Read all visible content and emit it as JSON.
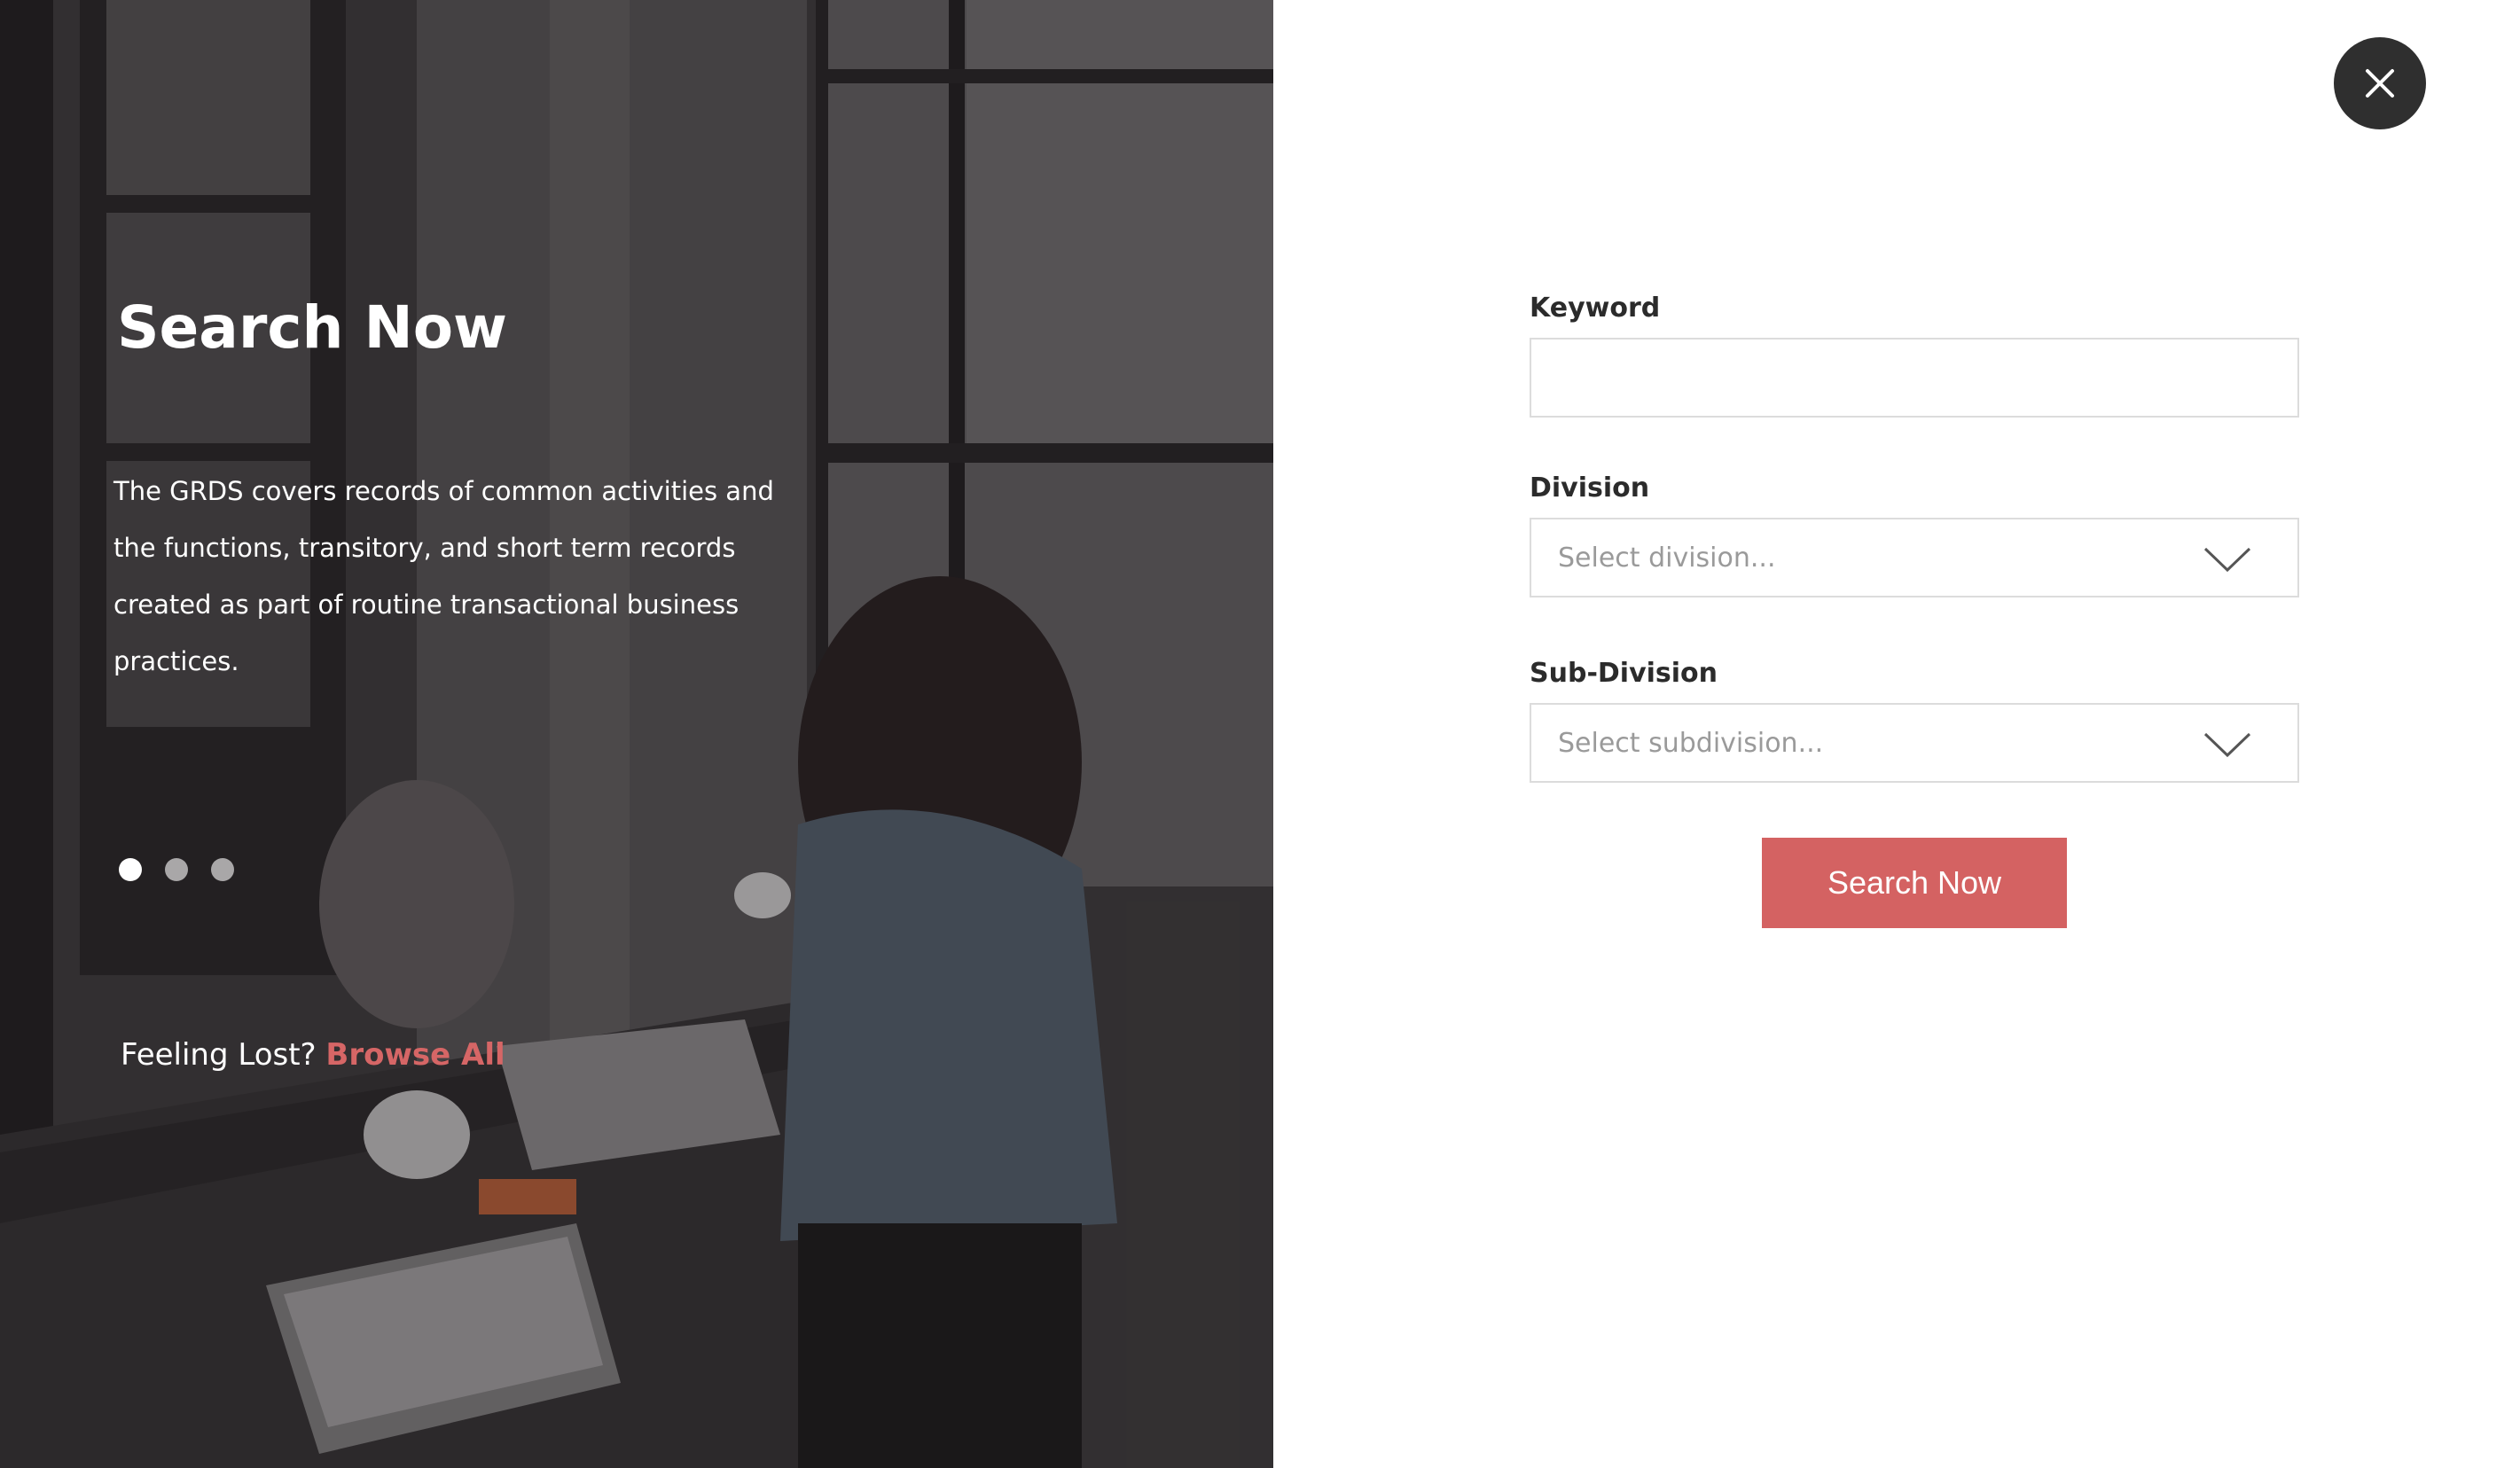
{
  "hero": {
    "title": "Search Now",
    "description": "The GRDS covers records of common activities and the functions, transitory, and short term records created as part of routine transactional business practices.",
    "lost_text": "Feeling Lost?",
    "browse_link": "Browse All"
  },
  "carousel": {
    "slides": 3,
    "active_index": 0
  },
  "form": {
    "keyword": {
      "label": "Keyword",
      "value": ""
    },
    "division": {
      "label": "Division",
      "placeholder": "Select division..."
    },
    "subdivision": {
      "label": "Sub-Division",
      "placeholder": "Select subdivision..."
    },
    "submit_label": "Search Now"
  },
  "icons": {
    "close": "close-icon",
    "chevron": "chevron-down-icon"
  },
  "colors": {
    "accent": "#d46262",
    "close_bg": "#2f2f2f",
    "input_border": "#dcdcdc",
    "placeholder": "#9a9a9a"
  }
}
